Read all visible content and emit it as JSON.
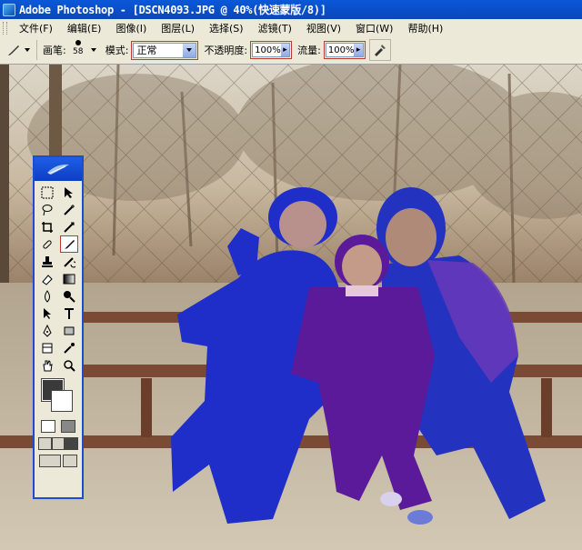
{
  "window": {
    "title": "Adobe Photoshop - [DSCN4093.JPG @ 40%(快速蒙版/8)]"
  },
  "menu": {
    "items": [
      "文件(F)",
      "编辑(E)",
      "图像(I)",
      "图层(L)",
      "选择(S)",
      "滤镜(T)",
      "视图(V)",
      "窗口(W)",
      "帮助(H)"
    ]
  },
  "options": {
    "brush_label": "画笔:",
    "brush_size": "58",
    "mode_label": "模式:",
    "mode_value": "正常",
    "opacity_label": "不透明度:",
    "opacity_value": "100%",
    "flow_label": "流量:",
    "flow_value": "100%"
  },
  "toolbox": {
    "tools": [
      "marquee-tool",
      "move-tool",
      "lasso-tool",
      "magic-wand-tool",
      "crop-tool",
      "slice-tool",
      "healing-brush-tool",
      "brush-tool",
      "clone-stamp-tool",
      "history-brush-tool",
      "eraser-tool",
      "gradient-tool",
      "blur-tool",
      "dodge-tool",
      "path-selection-tool",
      "type-tool",
      "pen-tool",
      "shape-tool",
      "notes-tool",
      "eyedropper-tool",
      "hand-tool",
      "zoom-tool"
    ],
    "active_tool": "brush-tool",
    "foreground_color": "#3a3a3a",
    "background_color": "#ffffff"
  },
  "colors": {
    "titlebar": "#0b4fd0",
    "highlight": "#c0392b",
    "quickmask_overlay": "#1a2ad6"
  }
}
